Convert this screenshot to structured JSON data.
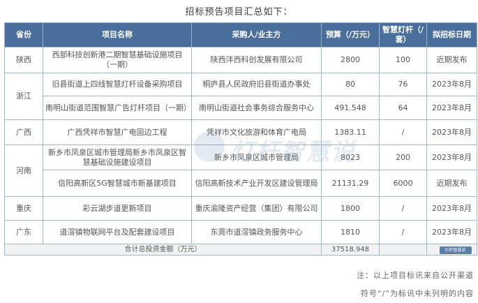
{
  "title": "招标预告项目汇总如下：",
  "table": {
    "headers": {
      "province": "省份",
      "project": "项目名称",
      "purchaser": "采购人/业主方",
      "budget": "预算（/万元）",
      "lights": "智慧灯杆（/套）",
      "date": "拟招标日期"
    },
    "rows": [
      {
        "province": "陕西",
        "project": "西部科技创新港二期智慧基础设施项目（一期）",
        "purchaser": "陕西沣西科创发展有限公司",
        "budget": "2800",
        "lights": "100",
        "date": "近期发布"
      },
      {
        "province": "浙江",
        "project": "旧县街道上四线智慧灯杆设备采购项目",
        "purchaser": "桐庐县人民政府旧县街道办事处",
        "budget": "80",
        "lights": "76",
        "date": "2023年8月"
      },
      {
        "project": "南明山街道范围智慧广告灯杆项目（一期）",
        "purchaser": "南明山街道社会事务综合服务中心",
        "budget": "491.548",
        "lights": "64",
        "date": "2023年8月"
      },
      {
        "province": "广西",
        "project": "广西凭祥市智慧广电固边工程",
        "purchaser": "凭祥市文化旅游和体育广电局",
        "budget": "1383.11",
        "lights": "/",
        "date": "2023年8月"
      },
      {
        "province": "河南",
        "project": "新乡市凤泉区城市管理局新乡市凤泉区智慧基础设施建设项目",
        "purchaser": "新乡市凤泉区城市管理局",
        "budget": "8023",
        "lights": "200",
        "date": "2023年8月"
      },
      {
        "project": "信阳高新区5G智慧城市新基建项目",
        "purchaser": "信阳高新技术产业开发区建设管理局",
        "budget": "21131.29",
        "lights": "6000",
        "date": "近期发布"
      },
      {
        "province": "重庆",
        "project": "彩云湖步道更新项目",
        "purchaser": "重庆渝隆资产经营（集团）有限公司",
        "budget": "1800",
        "lights": "/",
        "date": "2023年8月"
      },
      {
        "province": "广东",
        "project": "道滘镇物联网平台及配套建设项目",
        "purchaser": "东莞市道滘镇政务服务中心",
        "budget": "1810",
        "lights": "/",
        "date": "2023年8月"
      }
    ],
    "total_label": "合计总投资金额（万元）",
    "total_value": "37518.948",
    "mini_logo_text": "灯杆智慧说"
  },
  "watermark_text": "灯杆智慧说",
  "notes": {
    "line1": "注：以上项目标讯来自公开渠道",
    "line2": "符号“/”为标讯中未列明的内容"
  },
  "colors": {
    "header_bg": "#4a6e9c",
    "border": "#9fb7d0",
    "total_bg": "#f2f2f2"
  }
}
